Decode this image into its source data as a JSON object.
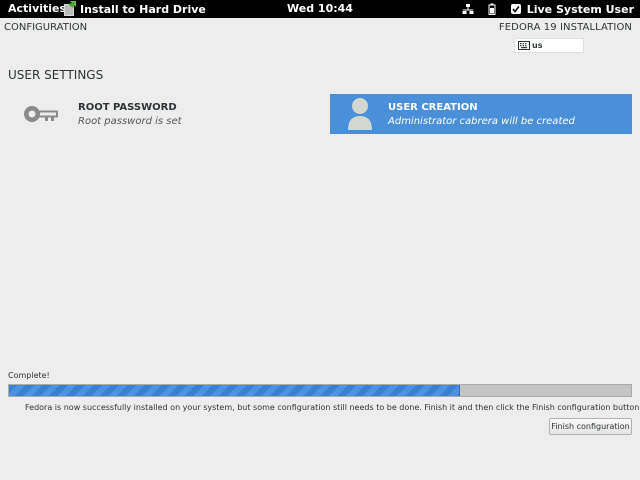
{
  "topbar": {
    "activities": "Activities",
    "app_label": "Install to Hard Drive",
    "clock": "Wed 10:44",
    "user": "Live System User",
    "tray_icons": [
      "network-icon",
      "battery-icon",
      "power-icon"
    ]
  },
  "header": {
    "hub_title": "CONFIGURATION",
    "product_title": "FEDORA 19 INSTALLATION",
    "keyboard_layout": "us"
  },
  "user_settings": {
    "section_title": "USER SETTINGS",
    "spokes": [
      {
        "title": "ROOT PASSWORD",
        "status": "Root password is set",
        "icon": "key-icon",
        "selected": false
      },
      {
        "title": "USER CREATION",
        "status": "Administrator cabrera will be created",
        "icon": "user-icon",
        "selected": true
      }
    ]
  },
  "progress": {
    "label": "Complete!",
    "fraction": 0.725,
    "message": "Fedora is now successfully installed on your system, but some configuration still needs to be done.  Finish it and then click the Finish configuration button please.",
    "finish_button": "Finish configuration"
  },
  "colors": {
    "accent": "#4a90d9",
    "progress_fill": "#3a7fd0",
    "background": "#ededed",
    "topbar": "#000000"
  }
}
